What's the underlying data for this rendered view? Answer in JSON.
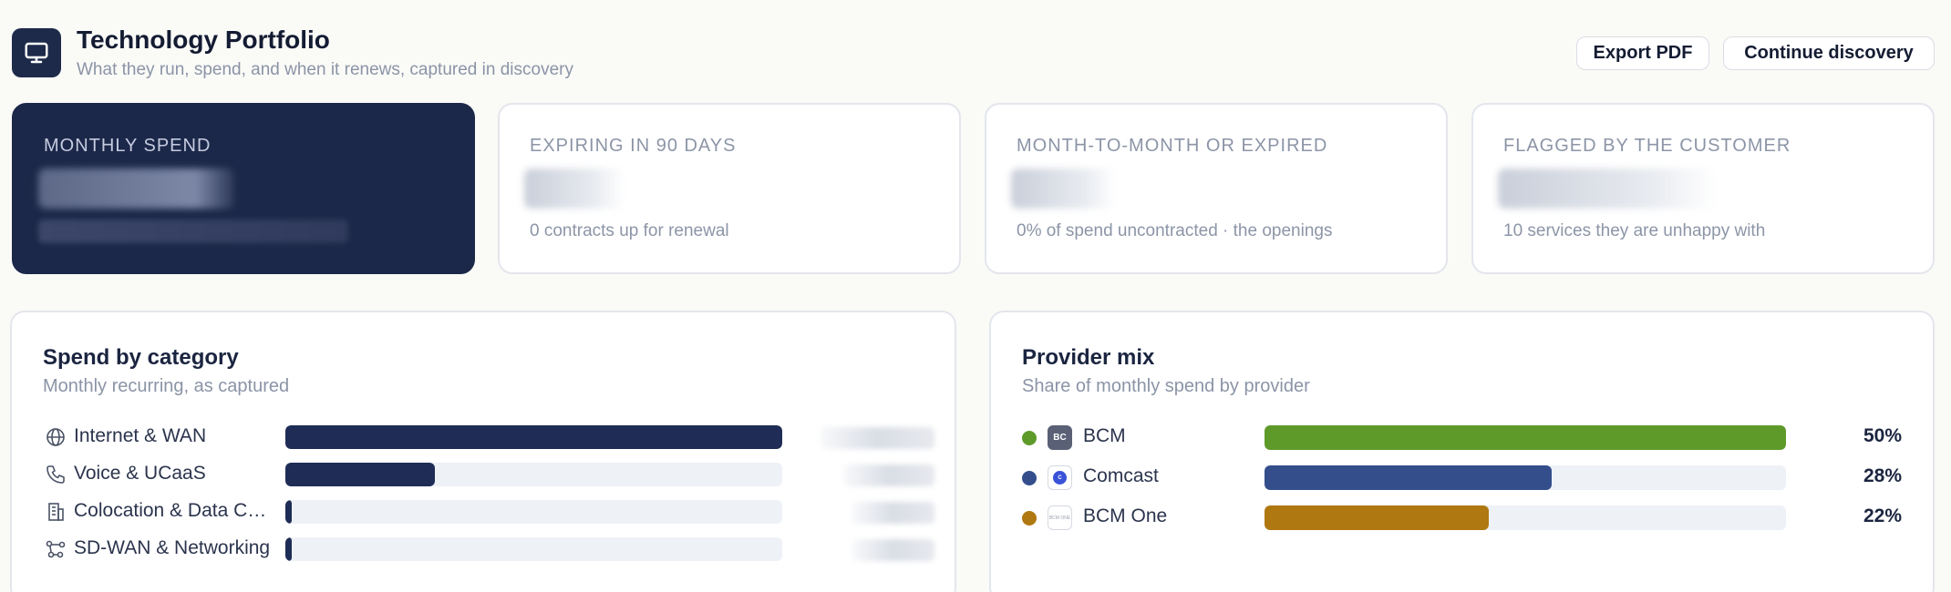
{
  "header": {
    "title": "Technology Portfolio",
    "subtitle": "What they run, spend, and when it renews, captured in discovery",
    "icon": "monitor-icon",
    "export_label": "Export PDF",
    "continue_label": "Continue discovery"
  },
  "kpis": [
    {
      "label": "Monthly spend",
      "sub": "",
      "dark": true
    },
    {
      "label": "Expiring in 90 days",
      "sub": "0 contracts up for renewal"
    },
    {
      "label": "Month-to-month or expired",
      "sub": "0% of spend uncontracted · the openings"
    },
    {
      "label": "Flagged by the customer",
      "sub": "10 services they are unhappy with"
    }
  ],
  "spend_by_category": {
    "title": "Spend by category",
    "subtitle": "Monthly recurring, as captured",
    "items": [
      {
        "label": "Internet & WAN",
        "icon": "globe-icon",
        "share": 1.0
      },
      {
        "label": "Voice & UCaaS",
        "icon": "phone-icon",
        "share": 0.3
      },
      {
        "label": "Colocation & Data Center",
        "icon": "building-icon",
        "share": 0.012
      },
      {
        "label": "SD-WAN & Networking",
        "icon": "network-icon",
        "share": 0.012
      }
    ]
  },
  "provider_mix": {
    "title": "Provider mix",
    "subtitle": "Share of monthly spend by provider",
    "items": [
      {
        "name": "BCM",
        "logo_text": "BC",
        "percent_label": "50%",
        "share": 1.0,
        "color": "#5e9a2a"
      },
      {
        "name": "Comcast",
        "logo_text": "C",
        "percent_label": "28%",
        "share": 0.55,
        "color": "#344e8c"
      },
      {
        "name": "BCM One",
        "logo_text": "BCM ONE",
        "percent_label": "22%",
        "share": 0.43,
        "color": "#b07811"
      }
    ]
  },
  "colors": {
    "navy": "#1c2849",
    "bar_navy": "#1e2c56",
    "track": "#eef1f6"
  }
}
